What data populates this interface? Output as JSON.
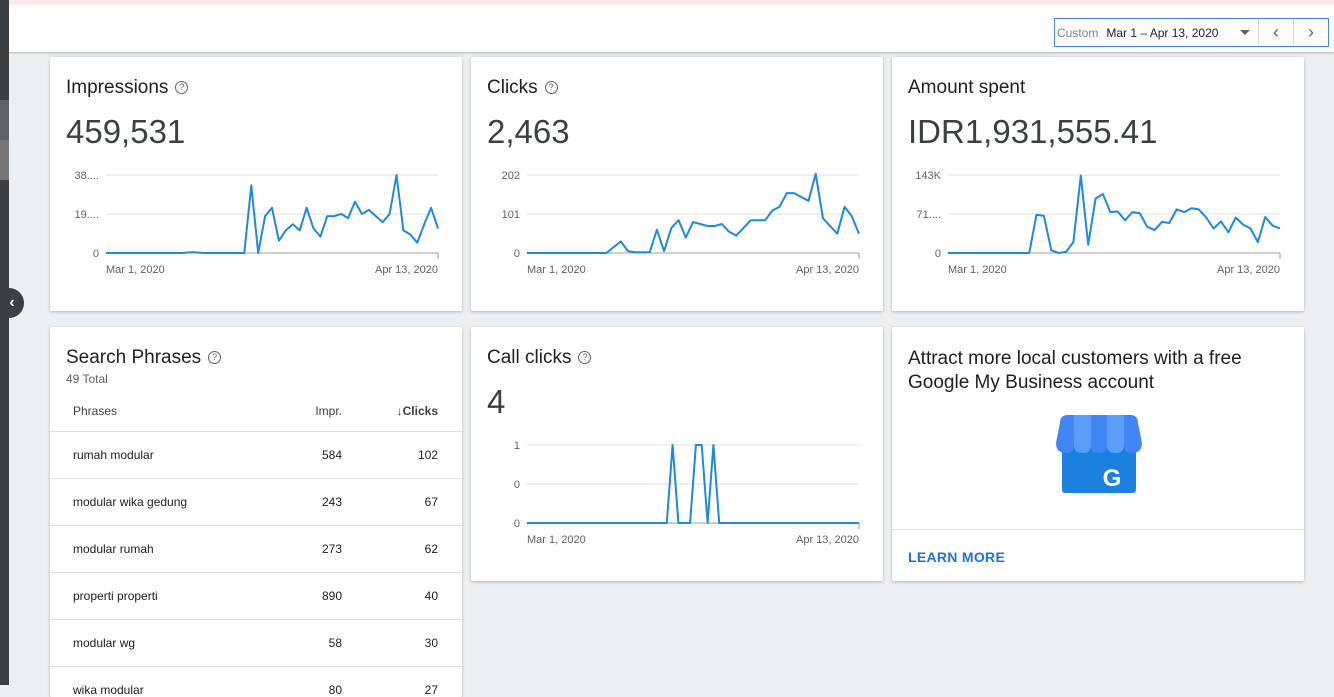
{
  "date_picker": {
    "label": "Custom",
    "range": "Mar 1 – Apr 13, 2020"
  },
  "colors": {
    "line": "#1e88e5",
    "accent": "#1a73e8"
  },
  "icons": {
    "help": "help-circle-icon",
    "prev": "chevron-left-icon",
    "next": "chevron-right-icon",
    "collapse": "chevron-left-icon"
  },
  "impressions": {
    "title": "Impressions",
    "value": "459,531",
    "chart_data": {
      "type": "line",
      "y_ticks": [
        "38....",
        "19....",
        "0"
      ],
      "x_ticks": [
        "Mar 1, 2020",
        "Apr 13, 2020"
      ],
      "ylim": [
        0,
        38000
      ],
      "values": [
        0,
        0,
        0,
        0,
        0,
        0,
        0,
        0,
        0,
        0,
        0,
        0,
        300,
        300,
        0,
        0,
        0,
        0,
        0,
        0,
        0,
        33000,
        0,
        18000,
        22000,
        6000,
        11000,
        14000,
        11000,
        22000,
        12000,
        8000,
        18000,
        18000,
        19000,
        17000,
        25000,
        19000,
        21000,
        18000,
        15000,
        19000,
        38000,
        11000,
        9000,
        5000,
        14000,
        22000,
        12000
      ]
    }
  },
  "clicks": {
    "title": "Clicks",
    "value": "2,463",
    "chart_data": {
      "type": "line",
      "y_ticks": [
        "202",
        "101",
        "0"
      ],
      "x_ticks": [
        "Mar 1, 2020",
        "Apr 13, 2020"
      ],
      "ylim": [
        0,
        202
      ],
      "values": [
        0,
        0,
        0,
        0,
        0,
        0,
        0,
        0,
        0,
        0,
        0,
        0,
        15,
        30,
        5,
        2,
        2,
        2,
        60,
        5,
        65,
        85,
        40,
        80,
        75,
        70,
        70,
        75,
        55,
        45,
        65,
        85,
        85,
        85,
        110,
        120,
        155,
        155,
        145,
        135,
        205,
        90,
        70,
        50,
        120,
        95,
        50
      ]
    }
  },
  "amount_spent": {
    "title": "Amount spent",
    "value": "IDR1,931,555.41",
    "chart_data": {
      "type": "line",
      "y_ticks": [
        "143K",
        "71....",
        "0"
      ],
      "x_ticks": [
        "Mar 1, 2020",
        "Apr 13, 2020"
      ],
      "ylim": [
        0,
        143000
      ],
      "values": [
        0,
        0,
        0,
        0,
        0,
        0,
        0,
        0,
        0,
        0,
        0,
        0,
        70000,
        68000,
        5000,
        0,
        2000,
        20000,
        142000,
        15000,
        100000,
        108000,
        75000,
        76000,
        60000,
        75000,
        73000,
        48000,
        42000,
        57000,
        55000,
        80000,
        75000,
        82000,
        80000,
        65000,
        45000,
        58000,
        38000,
        65000,
        52000,
        45000,
        20000,
        66000,
        50000,
        45000
      ]
    }
  },
  "search_phrases": {
    "title": "Search Phrases",
    "subtotal": "49 Total",
    "headers": {
      "phrase": "Phrases",
      "impr": "Impr.",
      "clicks": "Clicks"
    },
    "rows": [
      {
        "phrase": "rumah modular",
        "impr": "584",
        "clicks": "102"
      },
      {
        "phrase": "modular wika gedung",
        "impr": "243",
        "clicks": "67"
      },
      {
        "phrase": "modular rumah",
        "impr": "273",
        "clicks": "62"
      },
      {
        "phrase": "properti properti",
        "impr": "890",
        "clicks": "40"
      },
      {
        "phrase": "modular wg",
        "impr": "58",
        "clicks": "30"
      },
      {
        "phrase": "wika modular",
        "impr": "80",
        "clicks": "27"
      }
    ]
  },
  "call_clicks": {
    "title": "Call clicks",
    "value": "4",
    "chart_data": {
      "type": "line",
      "y_ticks": [
        "1",
        "0",
        "0"
      ],
      "x_ticks": [
        "Mar 1, 2020",
        "Apr 13, 2020"
      ],
      "ylim": [
        0,
        1
      ],
      "values": [
        0,
        0,
        0,
        0,
        0,
        0,
        0,
        0,
        0,
        0,
        0,
        0,
        0,
        0,
        0,
        0,
        0,
        0,
        0,
        0,
        0,
        0,
        0,
        0,
        0,
        1,
        0,
        0,
        0,
        1,
        1,
        0,
        1,
        0,
        0,
        0,
        0,
        0,
        0,
        0,
        0,
        0,
        0,
        0,
        0,
        0,
        0,
        0,
        0,
        0,
        0,
        0,
        0,
        0,
        0,
        0,
        0,
        0
      ]
    }
  },
  "promo": {
    "title": "Attract more local customers with a free Google My Business account",
    "icon": "google-my-business-icon",
    "icon_letter": "G",
    "cta": "LEARN MORE"
  }
}
